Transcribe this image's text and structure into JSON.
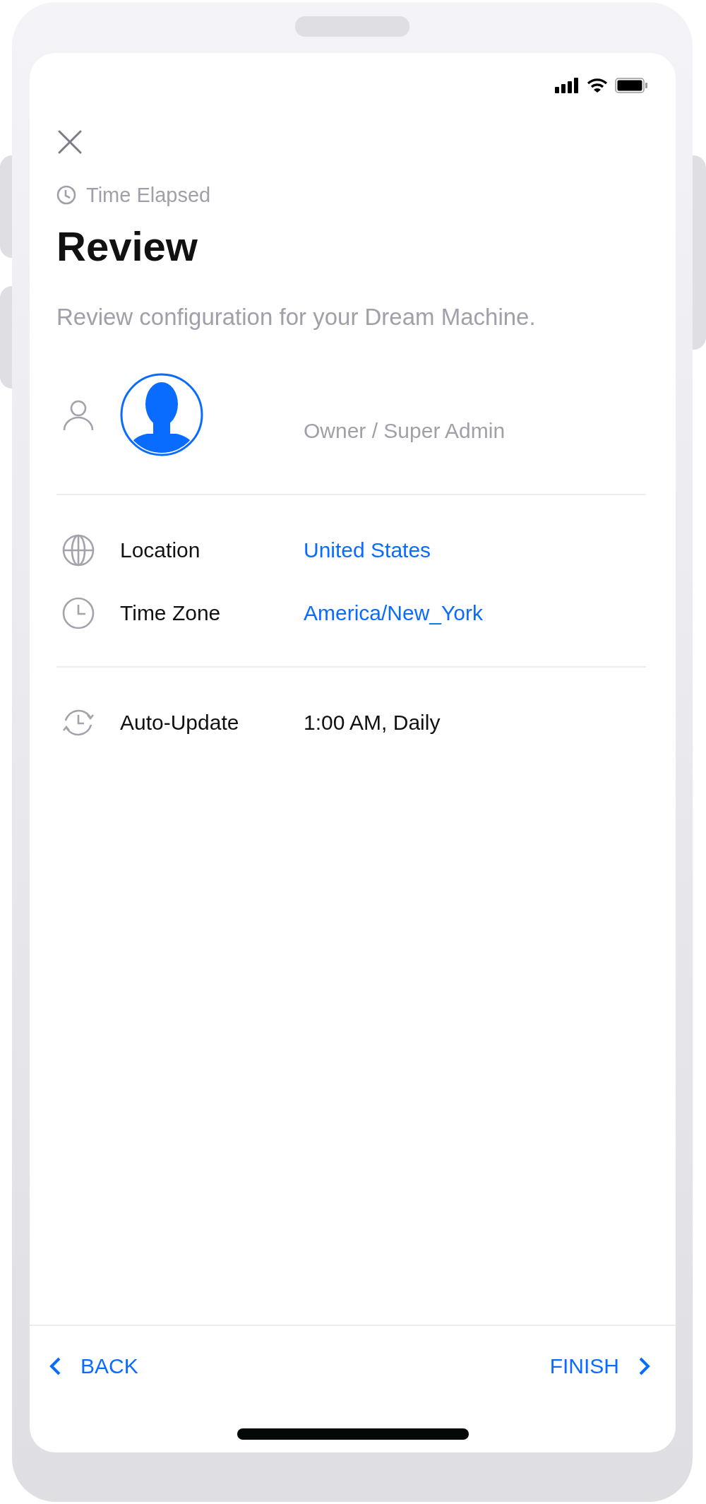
{
  "timer": {
    "label": "Time Elapsed"
  },
  "title": "Review",
  "subtitle": "Review configuration for your Dream Machine.",
  "account": {
    "role": "Owner / Super Admin"
  },
  "sections": [
    {
      "rows": [
        {
          "kind": "location",
          "label": "Location",
          "value": "United States",
          "link": true
        },
        {
          "kind": "timezone",
          "label": "Time Zone",
          "value": "America/New_York",
          "link": true
        }
      ]
    },
    {
      "rows": [
        {
          "kind": "update",
          "label": "Auto-Update",
          "value": "1:00 AM, Daily",
          "link": false
        }
      ]
    }
  ],
  "footer": {
    "back": "BACK",
    "finish": "FINISH"
  }
}
